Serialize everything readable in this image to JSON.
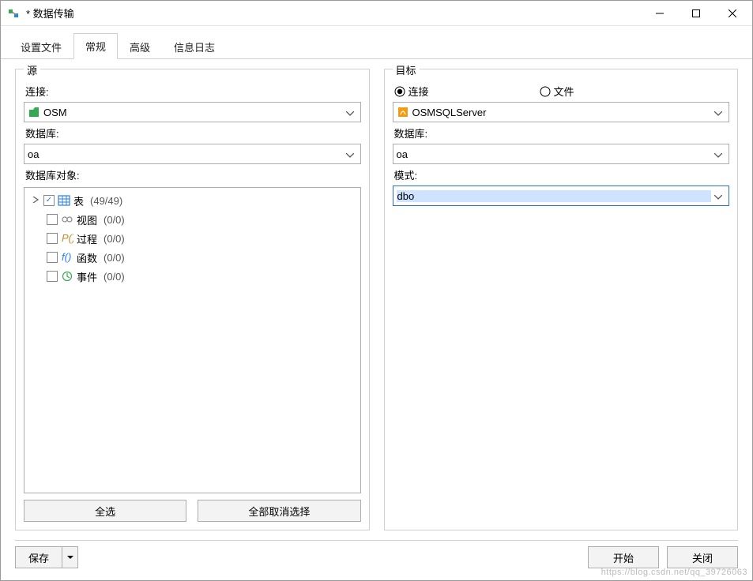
{
  "window": {
    "title": "* 数据传输"
  },
  "tabs": {
    "settings": "设置文件",
    "general": "常规",
    "advanced": "高级",
    "log": "信息日志"
  },
  "source": {
    "legend": "源",
    "conn_label": "连接:",
    "conn_value": "OSM",
    "db_label": "数据库:",
    "db_value": "oa",
    "obj_label": "数据库对象:",
    "objects": {
      "tables": {
        "label": "表",
        "count": "(49/49)"
      },
      "views": {
        "label": "视图",
        "count": "(0/0)"
      },
      "procedures": {
        "label": "过程",
        "count": "(0/0)"
      },
      "functions": {
        "label": "函数",
        "count": "(0/0)"
      },
      "events": {
        "label": "事件",
        "count": "(0/0)"
      }
    },
    "select_all": "全选",
    "deselect_all": "全部取消选择"
  },
  "target": {
    "legend": "目标",
    "radio_conn": "连接",
    "radio_file": "文件",
    "conn_value": "OSMSQLServer",
    "db_label": "数据库:",
    "db_value": "oa",
    "schema_label": "模式:",
    "schema_value": "dbo"
  },
  "footer": {
    "save": "保存",
    "start": "开始",
    "close": "关闭"
  },
  "watermark": "https://blog.csdn.net/qq_39726063"
}
